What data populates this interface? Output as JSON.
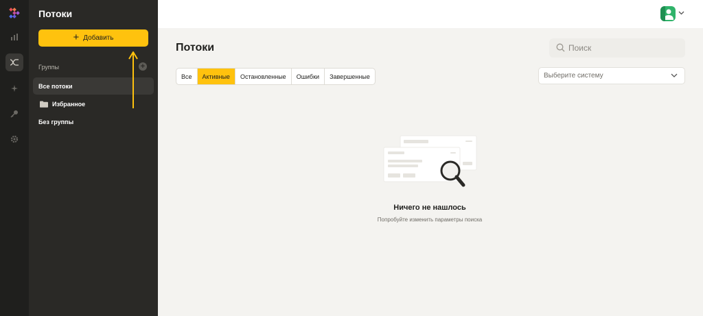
{
  "sidebar": {
    "title": "Потоки",
    "add_label": "Добавить",
    "groups_label": "Группы",
    "items": [
      {
        "label": "Все потоки",
        "active": true
      },
      {
        "label": "Избранное",
        "active": false
      },
      {
        "label": "Без группы",
        "active": false
      }
    ]
  },
  "rail": {
    "icons": [
      "analytics-icon",
      "flows-icon",
      "sparkle-icon",
      "key-icon",
      "settings-icon"
    ],
    "active": "flows-icon"
  },
  "main": {
    "title": "Потоки",
    "search": {
      "placeholder": "Поиск",
      "value": ""
    },
    "tabs": [
      {
        "label": "Все",
        "active": false
      },
      {
        "label": "Активные",
        "active": true
      },
      {
        "label": "Остановленные",
        "active": false
      },
      {
        "label": "Ошибки",
        "active": false
      },
      {
        "label": "Завершенные",
        "active": false
      }
    ],
    "system_select": {
      "placeholder": "Выберите систему"
    },
    "empty": {
      "title": "Ничего не нашлось",
      "subtitle": "Попробуйте изменить параметры поиска"
    }
  },
  "colors": {
    "accent": "#ffc20e",
    "rail_bg": "#1f1f1d",
    "sidebar_bg": "#2a2926",
    "main_bg": "#f4f3f0",
    "avatar": "#2fb36a"
  }
}
